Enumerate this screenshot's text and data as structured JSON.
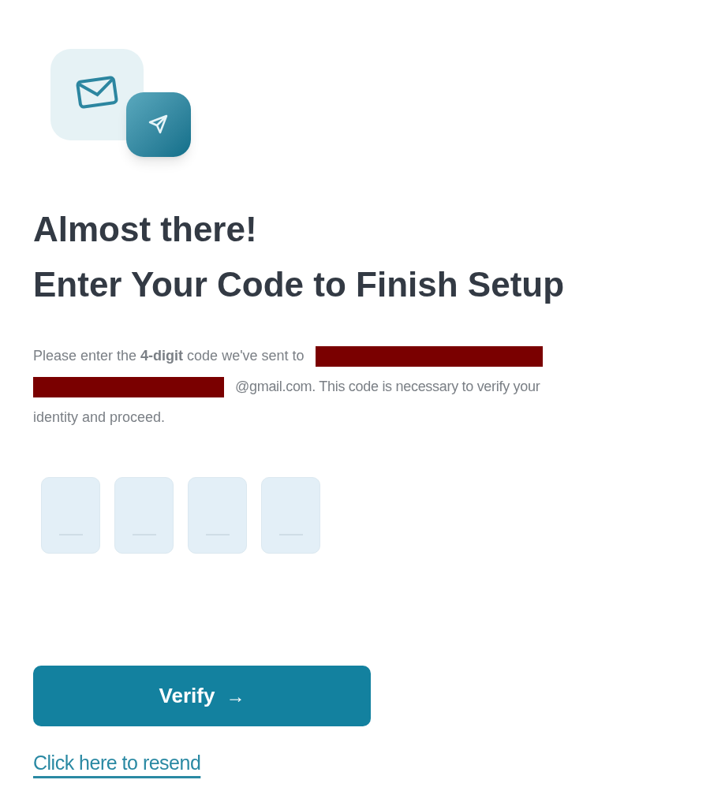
{
  "heading": [
    "Almost there!",
    "Enter Your Code to Finish Setup"
  ],
  "message_parts": [
    "Please enter the **4-digit** code we've sent to",
    "@gmail.com. This code is necessary to verify your",
    "identity and proceed."
  ],
  "code_fields": [
    {
      "focused": false
    },
    {
      "focused": false
    },
    {
      "focused": false
    },
    {
      "focused": false
    }
  ],
  "verify_button": {
    "label": "Verify",
    "icon": "→"
  },
  "resend_link": "Click here to resend"
}
